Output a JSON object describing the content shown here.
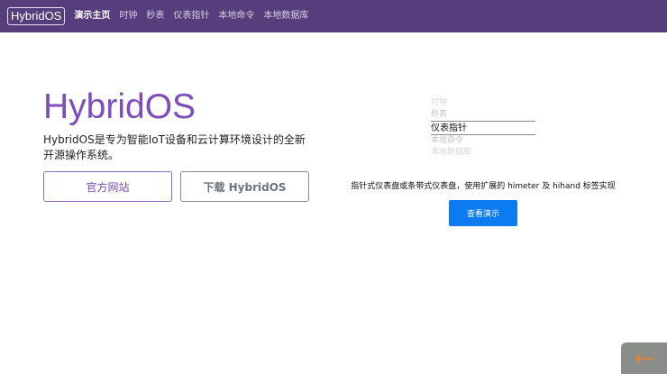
{
  "navbar": {
    "brand": "HybridOS",
    "items": [
      {
        "label": "演示主页",
        "active": true
      },
      {
        "label": "时钟",
        "active": false
      },
      {
        "label": "秒表",
        "active": false
      },
      {
        "label": "仪表指针",
        "active": false
      },
      {
        "label": "本地命令",
        "active": false
      },
      {
        "label": "本地数据库",
        "active": false
      }
    ]
  },
  "hero": {
    "title": "HybridOS",
    "description": "HybridOS是专为智能IoT设备和云计算环境设计的全新开源操作系统。",
    "primary_button": "官方网站",
    "secondary_button": "下载 HybridOS"
  },
  "picker": {
    "items": [
      "时钟",
      "秒表",
      "仪表指针",
      "本地命令",
      "本地数据库"
    ],
    "selected_index": 2
  },
  "demo": {
    "caption": "指针式仪表盘或条带式仪表盘，使用扩展的 himeter 及 hihand 标签实现",
    "button": "查看演示"
  },
  "back": {
    "icon": "arrow-left-icon",
    "color": "#e8862a"
  },
  "colors": {
    "nav": "#563d7c",
    "accent": "#7c4dbb",
    "demo_button": "#0d7cf2"
  }
}
